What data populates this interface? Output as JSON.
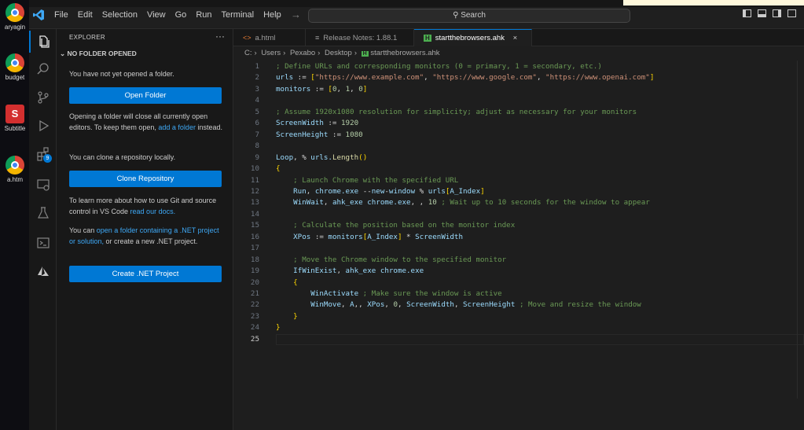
{
  "desktop": {
    "icons": [
      {
        "label": "aryagin",
        "kind": "chrome"
      },
      {
        "label": "budget",
        "kind": "chrome"
      },
      {
        "label": "Subtitle",
        "kind": "subtitle"
      },
      {
        "label": "a.htm",
        "kind": "chrome"
      }
    ]
  },
  "titlebar": {
    "menu": [
      "File",
      "Edit",
      "Selection",
      "View",
      "Go",
      "Run",
      "Terminal",
      "Help"
    ],
    "search_placeholder": "Search"
  },
  "activity_badge": "9",
  "sidebar": {
    "title": "EXPLORER",
    "more": "···",
    "section": "NO FOLDER OPENED",
    "not_opened_text": "You have not yet opened a folder.",
    "open_folder_label": "Open Folder",
    "close_text_prefix": "Opening a folder will close all currently open editors. To keep them open, ",
    "close_text_link": "add a folder",
    "close_text_suffix": " instead.",
    "clone_text": "You can clone a repository locally.",
    "clone_label": "Clone Repository",
    "git_text": "To learn more about how to use Git and source control in VS Code ",
    "git_link": "read our docs.",
    "net_text_prefix": "You can ",
    "net_link": "open a folder containing a .NET project or solution,",
    "net_text_suffix": " or create a new .NET project.",
    "net_button_label": "Create .NET Project"
  },
  "tabs": [
    {
      "label": "a.html",
      "icon": "<>",
      "active": false
    },
    {
      "label": "Release Notes: 1.88.1",
      "icon": "≡",
      "active": false
    },
    {
      "label": "startthebrowsers.ahk",
      "icon": "H",
      "active": true
    }
  ],
  "breadcrumb": [
    "C:",
    "Users",
    "Pexabo",
    "Desktop",
    "startthebrowsers.ahk"
  ],
  "code": {
    "lines": [
      "; Define URLs and corresponding monitors (0 = primary, 1 = secondary, etc.)",
      "urls := [\"https://www.example.com\", \"https://www.google.com\", \"https://www.openai.com\"]",
      "monitors := [0, 1, 0]",
      "",
      "; Assume 1920x1080 resolution for simplicity; adjust as necessary for your monitors",
      "ScreenWidth := 1920",
      "ScreenHeight := 1080",
      "",
      "Loop, % urls.Length()",
      "{",
      "    ; Launch Chrome with the specified URL",
      "    Run, chrome.exe --new-window % urls[A_Index]",
      "    WinWait, ahk_exe chrome.exe, , 10 ; Wait up to 10 seconds for the window to appear",
      "",
      "    ; Calculate the position based on the monitor index",
      "    XPos := monitors[A_Index] * ScreenWidth",
      "",
      "    ; Move the Chrome window to the specified monitor",
      "    IfWinExist, ahk_exe chrome.exe",
      "    {",
      "        WinActivate ; Make sure the window is active",
      "        WinMove, A,, XPos, 0, ScreenWidth, ScreenHeight ; Move and resize the window",
      "    }",
      "}",
      ""
    ],
    "current_line": 25
  }
}
